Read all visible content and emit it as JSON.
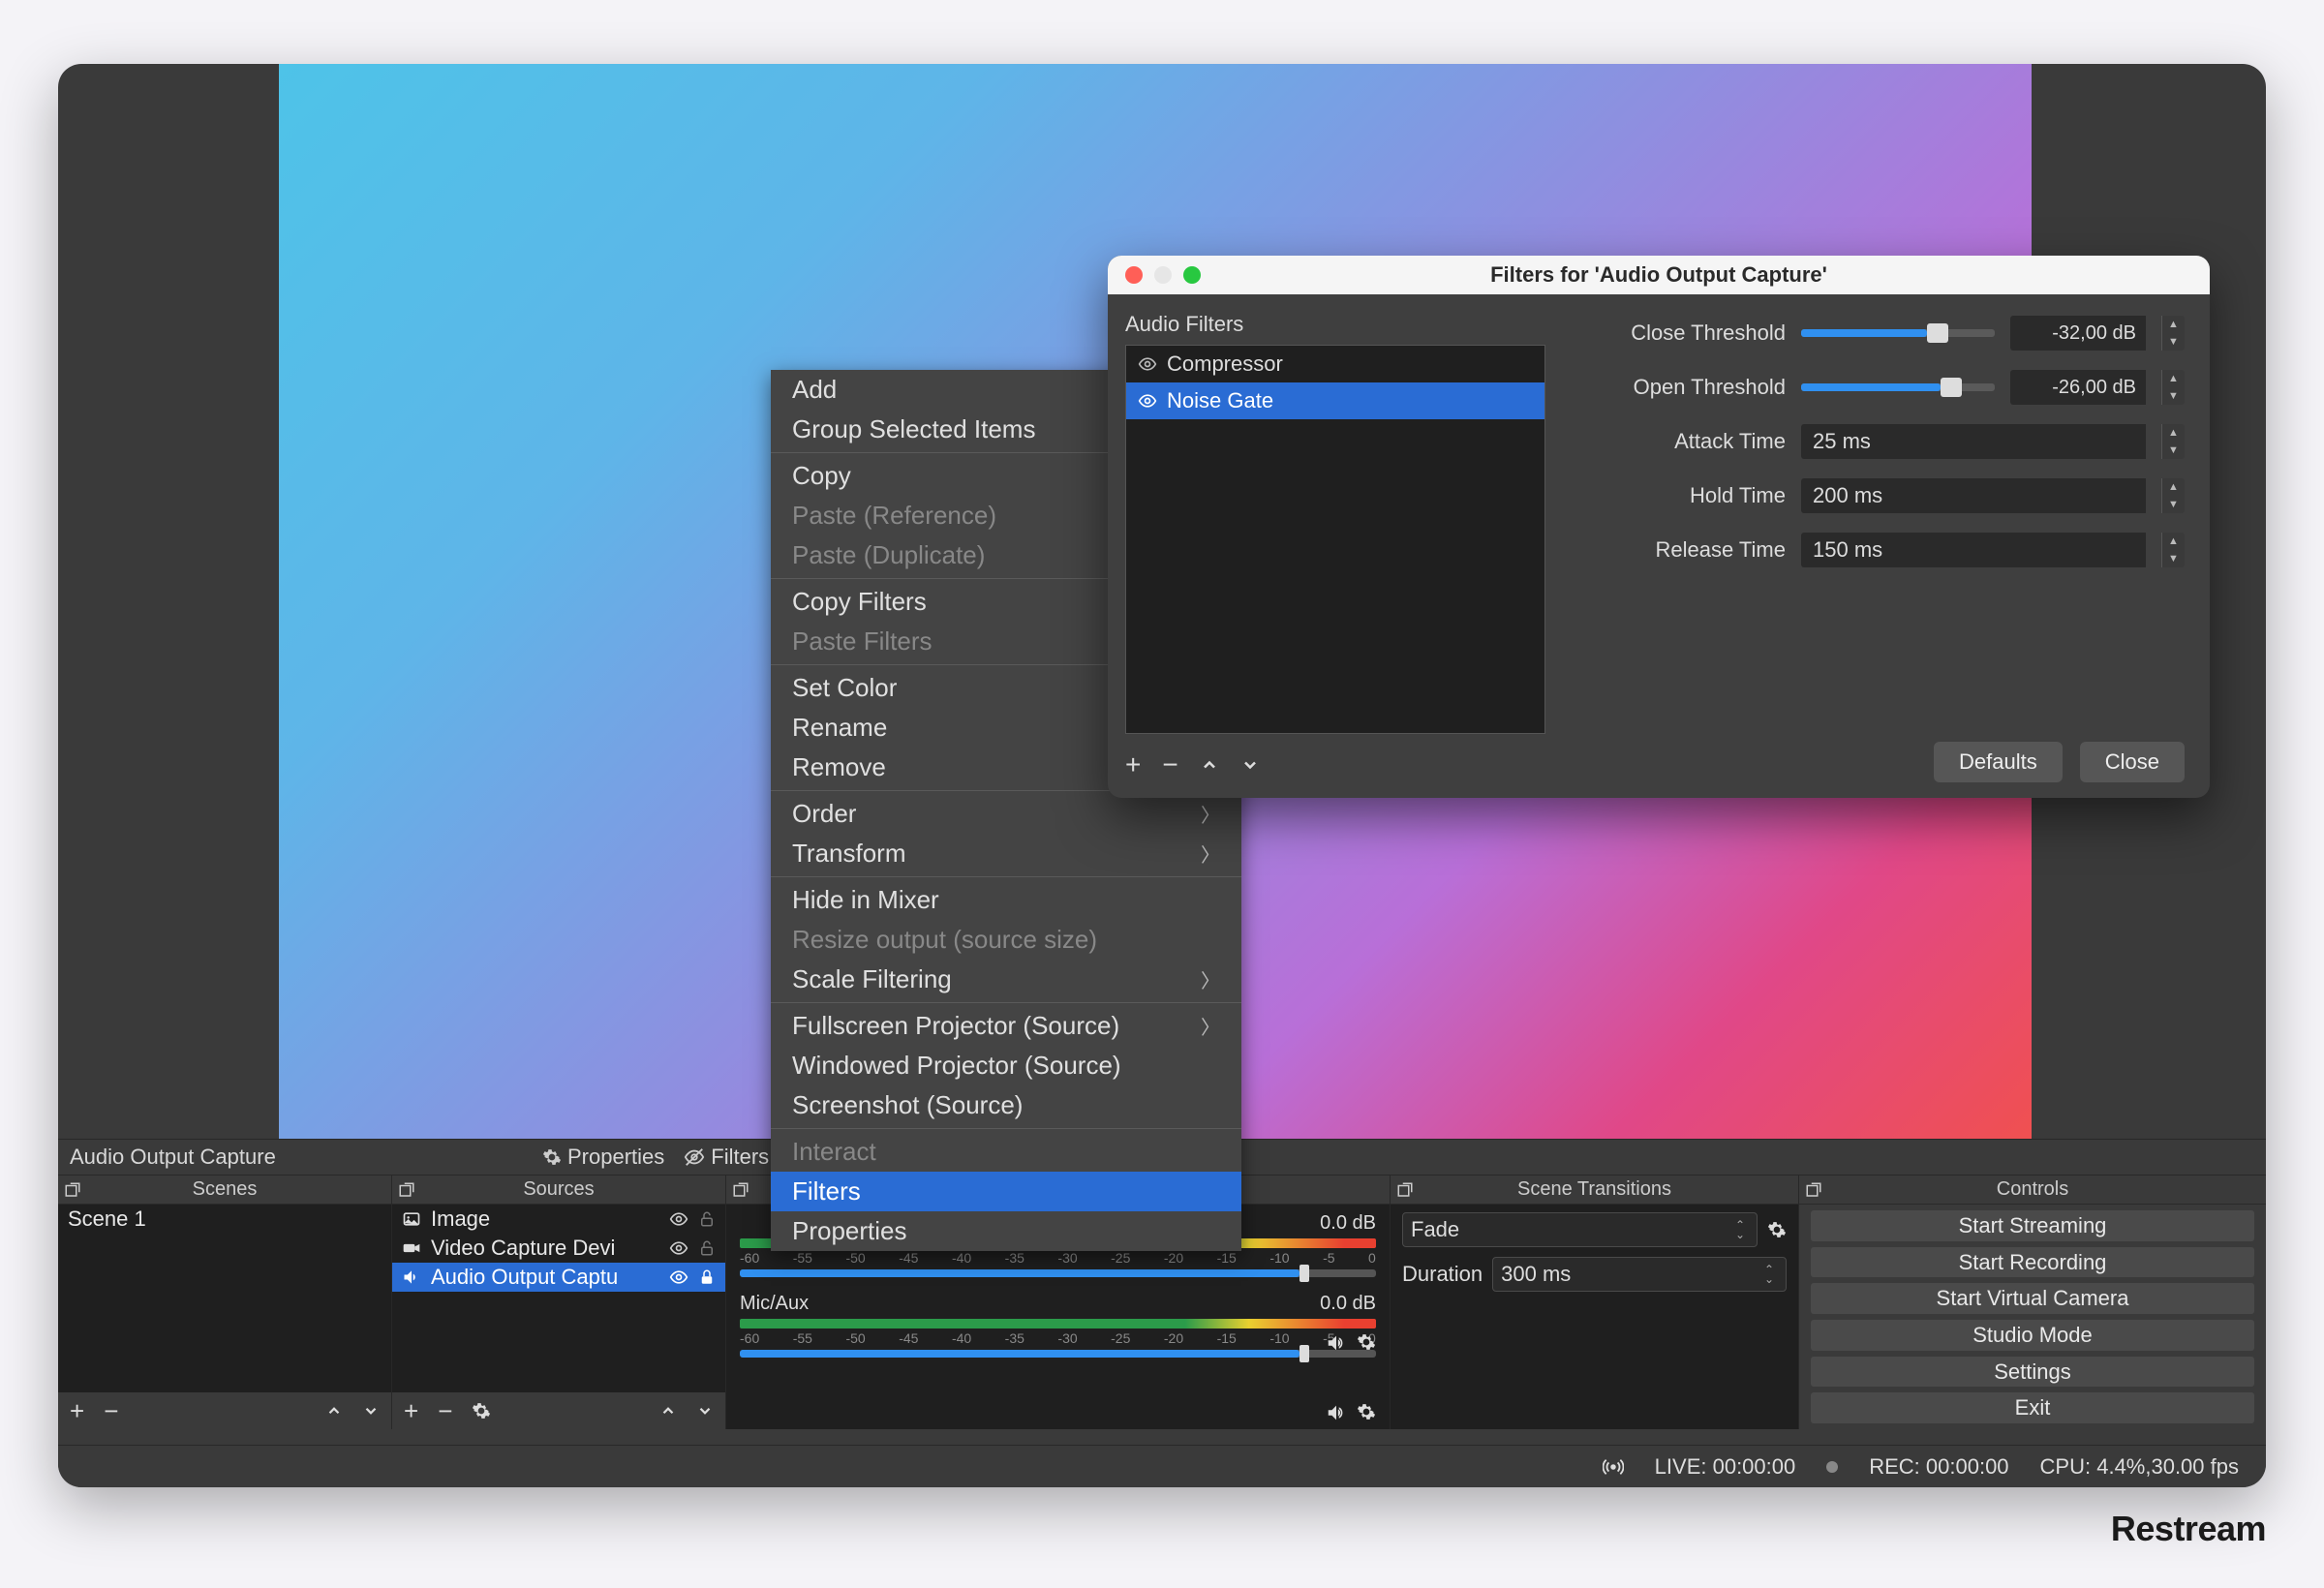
{
  "toolbar": {
    "source_label": "Audio Output Capture",
    "properties_label": "Properties",
    "filters_label": "Filters"
  },
  "panels": {
    "scenes": {
      "title": "Scenes",
      "items": [
        "Scene 1"
      ]
    },
    "sources": {
      "title": "Sources",
      "items": [
        {
          "icon": "image",
          "label": "Image",
          "selected": false,
          "locked": false
        },
        {
          "icon": "camera",
          "label": "Video Capture Devi",
          "selected": false,
          "locked": false
        },
        {
          "icon": "speaker",
          "label": "Audio Output Captu",
          "selected": true,
          "locked": true
        }
      ]
    },
    "mixer": {
      "channels": [
        {
          "name_visible": false,
          "level": "0.0 dB",
          "slider_pct": 88
        },
        {
          "name": "Mic/Aux",
          "level": "0.0 dB",
          "slider_pct": 88
        }
      ],
      "ticks": [
        "-60",
        "-55",
        "-50",
        "-45",
        "-40",
        "-35",
        "-30",
        "-25",
        "-20",
        "-15",
        "-10",
        "-5",
        "0"
      ]
    },
    "transitions": {
      "title": "Scene Transitions",
      "transition": "Fade",
      "duration_label": "Duration",
      "duration_value": "300 ms"
    },
    "controls": {
      "title": "Controls",
      "buttons": [
        "Start Streaming",
        "Start Recording",
        "Start Virtual Camera",
        "Studio Mode",
        "Settings",
        "Exit"
      ]
    }
  },
  "status": {
    "live": "LIVE: 00:00:00",
    "rec": "REC: 00:00:00",
    "cpu": "CPU: 4.4%,30.00 fps"
  },
  "context_menu": {
    "groups": [
      [
        {
          "label": "Add",
          "enabled": true
        },
        {
          "label": "Group Selected Items",
          "enabled": true
        }
      ],
      [
        {
          "label": "Copy",
          "enabled": true
        },
        {
          "label": "Paste (Reference)",
          "enabled": false
        },
        {
          "label": "Paste (Duplicate)",
          "enabled": false
        }
      ],
      [
        {
          "label": "Copy Filters",
          "enabled": true
        },
        {
          "label": "Paste Filters",
          "enabled": false
        }
      ],
      [
        {
          "label": "Set Color",
          "enabled": true
        },
        {
          "label": "Rename",
          "enabled": true
        },
        {
          "label": "Remove",
          "enabled": true
        }
      ],
      [
        {
          "label": "Order",
          "enabled": true,
          "submenu": true
        },
        {
          "label": "Transform",
          "enabled": true,
          "submenu": true
        }
      ],
      [
        {
          "label": "Hide in Mixer",
          "enabled": true
        },
        {
          "label": "Resize output (source size)",
          "enabled": false
        },
        {
          "label": "Scale Filtering",
          "enabled": true,
          "submenu": true
        }
      ],
      [
        {
          "label": "Fullscreen Projector (Source)",
          "enabled": true,
          "submenu": true
        },
        {
          "label": "Windowed Projector (Source)",
          "enabled": true
        },
        {
          "label": "Screenshot (Source)",
          "enabled": true
        }
      ],
      [
        {
          "label": "Interact",
          "enabled": false
        },
        {
          "label": "Filters",
          "enabled": true,
          "highlighted": true
        },
        {
          "label": "Properties",
          "enabled": true
        }
      ]
    ]
  },
  "dialog": {
    "title": "Filters for 'Audio Output Capture'",
    "left_title": "Audio Filters",
    "filters": [
      {
        "label": "Compressor",
        "selected": false
      },
      {
        "label": "Noise Gate",
        "selected": true
      }
    ],
    "params": {
      "close_threshold": {
        "label": "Close Threshold",
        "value": "-32,00 dB",
        "slider_pct": 65
      },
      "open_threshold": {
        "label": "Open Threshold",
        "value": "-26,00 dB",
        "slider_pct": 72
      },
      "attack_time": {
        "label": "Attack Time",
        "value": "25 ms"
      },
      "hold_time": {
        "label": "Hold Time",
        "value": "200 ms"
      },
      "release_time": {
        "label": "Release Time",
        "value": "150 ms"
      }
    },
    "buttons": {
      "defaults": "Defaults",
      "close": "Close"
    }
  },
  "watermark": "Restream"
}
